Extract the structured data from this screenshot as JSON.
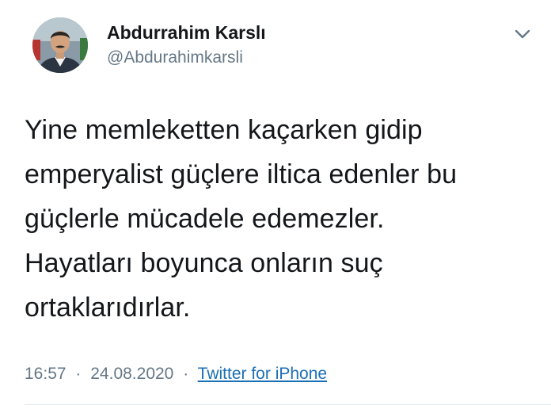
{
  "author": {
    "display_name": "Abdurrahim Karslı",
    "handle": "@Abdurahimkarsli",
    "avatar_icon": "profile-photo"
  },
  "menu": {
    "icon": "chevron-down-icon"
  },
  "tweet": {
    "text": "Yine memleketten kaçarken gidip\nemperyalist güçlere iltica edenler bu\ngüçlerle mücadele edemezler.\nHayatları boyunca onların suç\nortaklarıdırlar."
  },
  "meta": {
    "time": "16:57",
    "separator": "·",
    "date": "24.08.2020",
    "source": "Twitter for iPhone"
  },
  "colors": {
    "text_primary": "#14171a",
    "text_secondary": "#657786",
    "link": "#1b6fb5",
    "divider": "#e1e8ed"
  }
}
